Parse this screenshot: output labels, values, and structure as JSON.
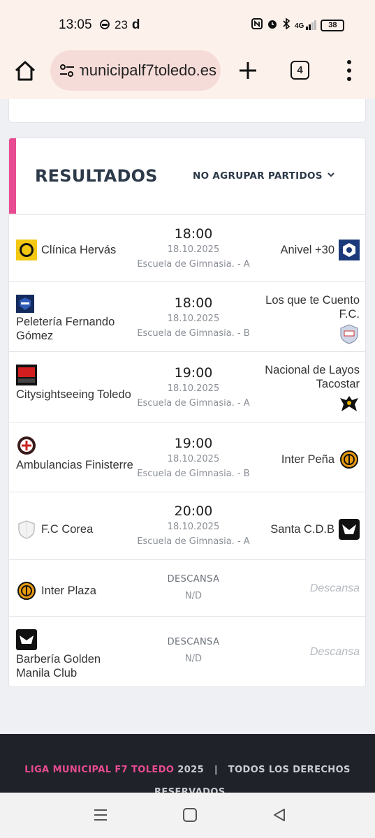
{
  "status_bar": {
    "time": "13:05",
    "notification_count": "23",
    "battery": "38",
    "icons": [
      "robot-icon",
      "temperature-icon",
      "d-app-icon",
      "nfc-icon",
      "alarm-icon",
      "bluetooth-icon",
      "signal-4g-icon",
      "battery-icon"
    ],
    "network_label": "4G"
  },
  "browser": {
    "url": "municipalf7toledo.es",
    "tab_count": "4",
    "icons": [
      "home-icon",
      "site-settings-icon",
      "new-tab-icon",
      "tabs-icon",
      "menu-icon"
    ]
  },
  "results": {
    "title": "RESULTADOS",
    "group_select": "NO AGRUPAR PARTIDOS",
    "accent_color": "#e84b92",
    "matches": [
      {
        "home": "Clínica Hervás",
        "time": "18:00",
        "date": "18.10.2025",
        "venue": "Escuela de Gimnasia. - A",
        "away": "Anivel +30"
      },
      {
        "home": "Peletería Fernando Gómez",
        "time": "18:00",
        "date": "18.10.2025",
        "venue": "Escuela de Gimnasia. - B",
        "away": "Los que te Cuento F.C."
      },
      {
        "home": "Citysightseeing Toledo",
        "time": "19:00",
        "date": "18.10.2025",
        "venue": "Escuela de Gimnasia. - A",
        "away": "Nacional de Layos Tacostar"
      },
      {
        "home": "Ambulancias Finisterre",
        "time": "19:00",
        "date": "18.10.2025",
        "venue": "Escuela de Gimnasia. - B",
        "away": "Inter Peña"
      },
      {
        "home": "F.C Corea",
        "time": "20:00",
        "date": "18.10.2025",
        "venue": "Escuela de Gimnasia. - A",
        "away": "Santa C.D.B"
      }
    ],
    "rests": [
      {
        "team": "Inter Plaza",
        "status": "DESCANSA",
        "info": "N/D",
        "away": "Descansa"
      },
      {
        "team": "Barbería Golden Manila Club",
        "status": "DESCANSA",
        "info": "N/D",
        "away": "Descansa"
      }
    ]
  },
  "footer": {
    "brand": "LIGA MUNICIPAL F7 TOLEDO",
    "year": "2025",
    "separator": "|",
    "rights": "TODOS LOS DERECHOS",
    "rights_cont": "RESERVADOS"
  },
  "nav": {
    "icons": [
      "recent-apps-icon",
      "home-nav-icon",
      "back-icon"
    ]
  }
}
